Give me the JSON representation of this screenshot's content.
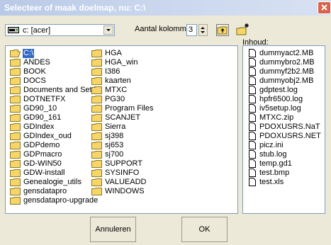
{
  "window": {
    "title": "Selecteer of maak doelmap, nu: C:\\"
  },
  "toolbar": {
    "drive": "c: [acer]",
    "columns_label": "Aantal kolommen:",
    "columns_value": "3"
  },
  "folders": {
    "col1": [
      "C:\\",
      "ANDES",
      "BOOK",
      "DOCS",
      "Documents and Setti",
      "DOTNETFX",
      "GD90_10",
      "GD90_161",
      "GDIndex",
      "GDIndex_oud",
      "GDPdemo",
      "GDPmacro",
      "GD-WIN50",
      "GDW-install",
      "Genealogie_utils",
      "gensdatapro",
      "gensdatapro-upgrade"
    ],
    "col2": [
      "HGA",
      "HGA_win",
      "I386",
      "kaarten",
      "MTXC",
      "PG30",
      "Program Files",
      "SCANJET",
      "Sierra",
      "sj398",
      "sj653",
      "sj700",
      "SUPPORT",
      "SYSINFO",
      "VALUEADD",
      "WINDOWS"
    ]
  },
  "files": {
    "label": "Inhoud:",
    "items": [
      "dummyact2.MB",
      "dummybro2.MB",
      "dummyf2b2.MB",
      "dummyobj2.MB",
      "gdptest.log",
      "hpfr6500.log",
      "iv5setup.log",
      "MTXC.zip",
      "PDOXUSRS.NaT",
      "PDOXUSRS.NET",
      "picz.ini",
      "stub.log",
      "temp.gd1",
      "test.bmp",
      "test.xls"
    ]
  },
  "buttons": {
    "cancel": "Annuleren",
    "ok": "OK"
  },
  "colors": {
    "selection": "#316ac5",
    "folder_yellow": "#f7d566",
    "window_bg": "#ece9d8"
  },
  "icons": {
    "folder": "folder-icon",
    "open_folder": "open-folder-icon",
    "file": "file-icon",
    "drive": "drive-icon",
    "up_folder": "up-folder-icon",
    "new_folder": "new-folder-icon",
    "close": "close-icon"
  }
}
